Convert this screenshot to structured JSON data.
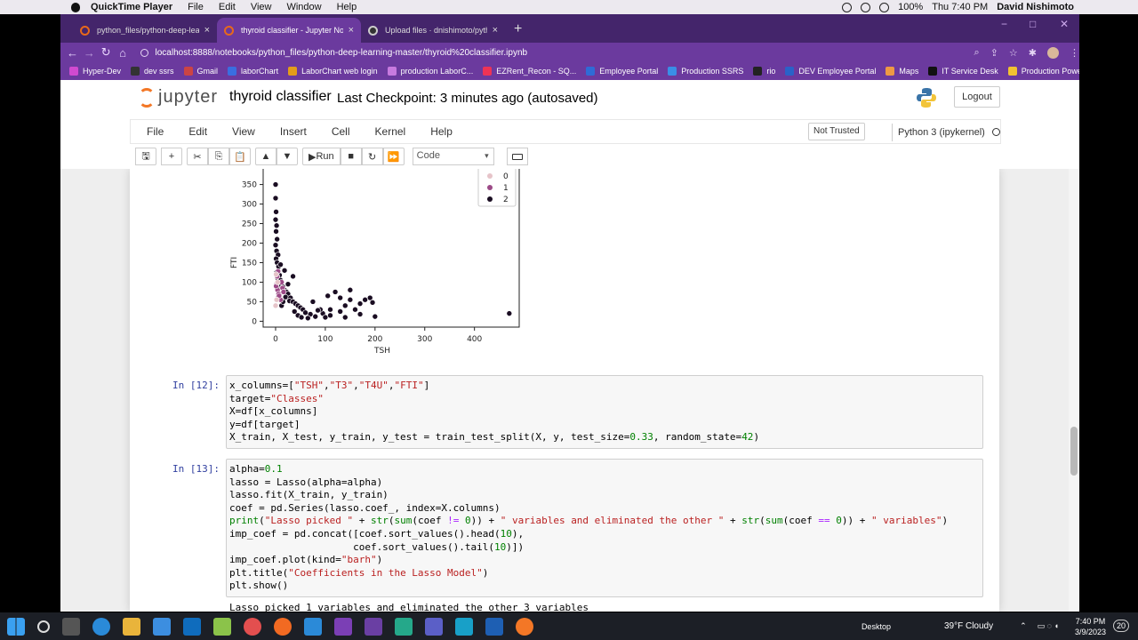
{
  "macbar": {
    "app": "QuickTime Player",
    "menus": [
      "File",
      "Edit",
      "View",
      "Window",
      "Help"
    ],
    "battery": "100%",
    "clock": "Thu 7:40 PM",
    "user": "David Nishimoto"
  },
  "tabs": [
    {
      "label": "python_files/python-deep-learni",
      "active": false,
      "close": "×"
    },
    {
      "label": "thyroid classifier - Jupyter Noteb",
      "active": true,
      "close": "×"
    },
    {
      "label": "Upload files · dnishimoto/python",
      "active": false,
      "close": "×"
    }
  ],
  "newtab": "+",
  "window_controls": {
    "min": "−",
    "max": "□",
    "close": "✕"
  },
  "address": {
    "url": "localhost:8888/notebooks/python_files/python-deep-learning-master/thyroid%20classifier.ipynb",
    "back": "←",
    "forward": "→",
    "reload": "↻",
    "home": "⌂"
  },
  "bookmarks": [
    "Hyper-Dev",
    "dev ssrs",
    "Gmail",
    "laborChart",
    "LaborChart web login",
    "production LaborC...",
    "EZRent_Recon - SQ...",
    "Employee Portal",
    "Production SSRS",
    "rio",
    "DEV Employee Portal",
    "Maps",
    "IT Service Desk",
    "Production PowerBI"
  ],
  "bookmarks_more": "»",
  "jupyter": {
    "logo": "jupyter",
    "title": "thyroid classifier",
    "checkpoint": "Last Checkpoint: 3 minutes ago  (autosaved)",
    "logout": "Logout",
    "not_trusted": "Not Trusted",
    "kernel": "Python 3 (ipykernel)"
  },
  "menus": [
    "File",
    "Edit",
    "View",
    "Insert",
    "Cell",
    "Kernel",
    "Help"
  ],
  "toolbar": {
    "run": "Run",
    "cell_type": "Code",
    "save": "🖫",
    "add": "+",
    "cut": "✂",
    "copy": "⎘",
    "paste": "📋",
    "up": "▲",
    "down": "▼",
    "stop": "■",
    "restart": "↻",
    "fast_forward": "⏩"
  },
  "chart_data": {
    "type": "scatter",
    "xlabel": "TSH",
    "ylabel": "FTI",
    "xticks": [
      0,
      100,
      200,
      300,
      400
    ],
    "yticks": [
      0,
      50,
      100,
      150,
      200,
      250,
      300,
      350
    ],
    "legend": [
      "0",
      "1",
      "2"
    ],
    "legend_position": "top-right",
    "colors": {
      "0": "#e6c4c9",
      "1": "#9c4a87",
      "2": "#1a0d22"
    },
    "points_class2": [
      [
        0,
        350
      ],
      [
        0,
        315
      ],
      [
        1,
        280
      ],
      [
        0,
        260
      ],
      [
        2,
        245
      ],
      [
        1,
        230
      ],
      [
        3,
        210
      ],
      [
        0,
        195
      ],
      [
        2,
        180
      ],
      [
        5,
        170
      ],
      [
        1,
        160
      ],
      [
        3,
        150
      ],
      [
        6,
        140
      ],
      [
        2,
        125
      ],
      [
        8,
        118
      ],
      [
        4,
        110
      ],
      [
        10,
        105
      ],
      [
        6,
        98
      ],
      [
        12,
        92
      ],
      [
        15,
        88
      ],
      [
        18,
        80
      ],
      [
        22,
        75
      ],
      [
        25,
        70
      ],
      [
        20,
        62
      ],
      [
        30,
        60
      ],
      [
        28,
        52
      ],
      [
        35,
        50
      ],
      [
        40,
        45
      ],
      [
        45,
        40
      ],
      [
        50,
        35
      ],
      [
        55,
        30
      ],
      [
        38,
        25
      ],
      [
        60,
        22
      ],
      [
        45,
        15
      ],
      [
        70,
        18
      ],
      [
        52,
        10
      ],
      [
        80,
        12
      ],
      [
        65,
        8
      ],
      [
        95,
        20
      ],
      [
        100,
        10
      ],
      [
        110,
        30
      ],
      [
        120,
        75
      ],
      [
        130,
        60
      ],
      [
        140,
        40
      ],
      [
        150,
        55
      ],
      [
        160,
        30
      ],
      [
        170,
        45
      ],
      [
        180,
        55
      ],
      [
        190,
        60
      ],
      [
        195,
        48
      ],
      [
        130,
        25
      ],
      [
        110,
        15
      ],
      [
        140,
        10
      ],
      [
        170,
        18
      ],
      [
        200,
        12
      ],
      [
        90,
        30
      ],
      [
        75,
        50
      ],
      [
        85,
        28
      ],
      [
        105,
        65
      ],
      [
        150,
        80
      ],
      [
        470,
        20
      ],
      [
        12,
        40
      ],
      [
        5,
        60
      ],
      [
        8,
        70
      ],
      [
        15,
        50
      ],
      [
        3,
        85
      ],
      [
        25,
        95
      ],
      [
        35,
        115
      ],
      [
        18,
        130
      ],
      [
        10,
        145
      ]
    ],
    "points_class1": [
      [
        2,
        95
      ],
      [
        4,
        80
      ],
      [
        6,
        70
      ],
      [
        8,
        60
      ],
      [
        10,
        55
      ],
      [
        3,
        115
      ],
      [
        5,
        128
      ],
      [
        12,
        100
      ],
      [
        14,
        85
      ],
      [
        16,
        75
      ],
      [
        7,
        65
      ],
      [
        1,
        90
      ]
    ],
    "points_class0": [
      [
        0,
        40
      ],
      [
        2,
        55
      ],
      [
        4,
        100
      ],
      [
        1,
        120
      ]
    ]
  },
  "cells": [
    {
      "prompt": "In [12]:",
      "lines": [
        [
          [
            "t",
            "x_columns=["
          ],
          [
            "s",
            "\"TSH\""
          ],
          [
            "t",
            ","
          ],
          [
            "s",
            "\"T3\""
          ],
          [
            "t",
            ","
          ],
          [
            "s",
            "\"T4U\""
          ],
          [
            "t",
            ","
          ],
          [
            "s",
            "\"FTI\""
          ],
          [
            "t",
            "]"
          ]
        ],
        [
          [
            "t",
            "target="
          ],
          [
            "s",
            "\"Classes\""
          ]
        ],
        [
          [
            "t",
            "X=df[x_columns]"
          ]
        ],
        [
          [
            "t",
            "y=df[target]"
          ]
        ],
        [
          [
            "t",
            "X_train, X_test, y_train, y_test = train_test_split(X, y, test_size="
          ],
          [
            "n",
            "0.33"
          ],
          [
            "t",
            ", random_state="
          ],
          [
            "n",
            "42"
          ],
          [
            "t",
            ")"
          ]
        ]
      ]
    },
    {
      "prompt": "In [13]:",
      "lines": [
        [
          [
            "t",
            "alpha="
          ],
          [
            "n",
            "0.1"
          ]
        ],
        [
          [
            "t",
            "lasso = Lasso(alpha=alpha)"
          ]
        ],
        [
          [
            "t",
            "lasso.fit(X_train, y_train)"
          ]
        ],
        [
          [
            "t",
            "coef = pd.Series(lasso.coef_, index=X.columns)"
          ]
        ],
        [
          [
            "b",
            "print"
          ],
          [
            "t",
            "("
          ],
          [
            "s",
            "\"Lasso picked \""
          ],
          [
            "t",
            " + "
          ],
          [
            "b",
            "str"
          ],
          [
            "t",
            "("
          ],
          [
            "b",
            "sum"
          ],
          [
            "t",
            "(coef "
          ],
          [
            "k",
            "!="
          ],
          [
            "t",
            " "
          ],
          [
            "n",
            "0"
          ],
          [
            "t",
            ")) + "
          ],
          [
            "s",
            "\" variables and eliminated the other \""
          ],
          [
            "t",
            " + "
          ],
          [
            "b",
            "str"
          ],
          [
            "t",
            "("
          ],
          [
            "b",
            "sum"
          ],
          [
            "t",
            "(coef "
          ],
          [
            "k",
            "=="
          ],
          [
            "t",
            " "
          ],
          [
            "n",
            "0"
          ],
          [
            "t",
            ")) + "
          ],
          [
            "s",
            "\" variables\""
          ],
          [
            "t",
            ")"
          ]
        ],
        [
          [
            "t",
            "imp_coef = pd.concat([coef.sort_values().head("
          ],
          [
            "n",
            "10"
          ],
          [
            "t",
            "),"
          ]
        ],
        [
          [
            "t",
            "                     coef.sort_values().tail("
          ],
          [
            "n",
            "10"
          ],
          [
            "t",
            ")])"
          ]
        ],
        [
          [
            "t",
            "imp_coef.plot(kind="
          ],
          [
            "s",
            "\"barh\""
          ],
          [
            "t",
            ")"
          ]
        ],
        [
          [
            "t",
            "plt.title("
          ],
          [
            "s",
            "\"Coefficients in the Lasso Model\""
          ],
          [
            "t",
            ")"
          ]
        ],
        [
          [
            "t",
            "plt.show()"
          ]
        ]
      ]
    }
  ],
  "output": "Lasso picked 1 variables and eliminated the other 3 variables",
  "taskbar": {
    "desktop": "Desktop",
    "weather": "39°F  Cloudy",
    "time": "7:40 PM",
    "date": "3/9/2023",
    "badge": "20"
  }
}
